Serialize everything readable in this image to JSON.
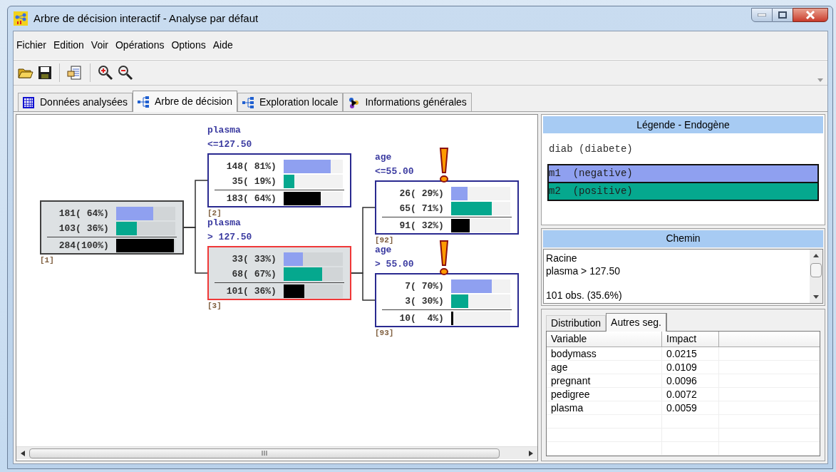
{
  "window": {
    "title": "Arbre de décision interactif - Analyse par défaut"
  },
  "menu": [
    "Fichier",
    "Edition",
    "Voir",
    "Opérations",
    "Options",
    "Aide"
  ],
  "tabs": [
    {
      "label": "Données analysées",
      "selected": false,
      "kind": "grid"
    },
    {
      "label": "Arbre de décision",
      "selected": true,
      "kind": "tree"
    },
    {
      "label": "Exploration locale",
      "selected": false,
      "kind": "tree"
    },
    {
      "label": "Informations générales",
      "selected": false,
      "kind": "info"
    }
  ],
  "tree": {
    "id_label": "[1]",
    "selected": false,
    "rows": [
      {
        "text": "181( 64%)",
        "level": 0.64
      },
      {
        "text": "103( 36%)",
        "level": 0.36
      }
    ],
    "total": {
      "text": "284(100%)",
      "level": 1
    },
    "children": [
      {
        "variable": "plasma",
        "condition": "<=127.50",
        "id_label": "[2]",
        "selected": false,
        "rows": [
          {
            "text": "148( 81%)",
            "level": 0.81
          },
          {
            "text": "35( 19%)",
            "level": 0.19
          }
        ],
        "total": {
          "text": "183( 64%)",
          "level": 0.64
        }
      },
      {
        "variable": "plasma",
        "condition": "> 127.50",
        "id_label": "[3]",
        "selected": true,
        "rows": [
          {
            "text": "33( 33%)",
            "level": 0.33
          },
          {
            "text": "68( 67%)",
            "level": 0.67
          }
        ],
        "total": {
          "text": "101( 36%)",
          "level": 0.36
        },
        "children": [
          {
            "variable": "age",
            "condition": "<=55.00",
            "id_label": "[92]",
            "selected": false,
            "warning": true,
            "rows": [
              {
                "text": "26( 29%)",
                "level": 0.29
              },
              {
                "text": "65( 71%)",
                "level": 0.71
              }
            ],
            "total": {
              "text": "91( 32%)",
              "level": 0.32
            }
          },
          {
            "variable": "age",
            "condition": "> 55.00",
            "id_label": "[93]",
            "selected": false,
            "warning": true,
            "rows": [
              {
                "text": "7( 70%)",
                "level": 0.7
              },
              {
                "text": "3( 30%)",
                "level": 0.3
              }
            ],
            "total": {
              "text": "10(  4%)",
              "level": 0.04
            }
          }
        ]
      }
    ]
  },
  "legend": {
    "title": "Légende - Endogène",
    "variable": "diab (diabete)",
    "classes": [
      {
        "label": "m1  (negative)",
        "color": "#8fa0f0"
      },
      {
        "label": "m2  (positive)",
        "color": "#05a88e"
      }
    ]
  },
  "path": {
    "title": "Chemin",
    "lines": [
      "Racine",
      "plasma > 127.50"
    ],
    "summary": "101 obs. (35.6%)"
  },
  "bottom_tabs": [
    {
      "label": "Distribution",
      "selected": false
    },
    {
      "label": "Autres seg.",
      "selected": true
    }
  ],
  "table": {
    "columns": [
      "Variable",
      "Impact"
    ],
    "rows": [
      [
        "bodymass",
        "0.0215"
      ],
      [
        "age",
        "0.0109"
      ],
      [
        "pregnant",
        "0.0096"
      ],
      [
        "pedigree",
        "0.0072"
      ],
      [
        "plasma",
        "0.0059"
      ]
    ]
  }
}
